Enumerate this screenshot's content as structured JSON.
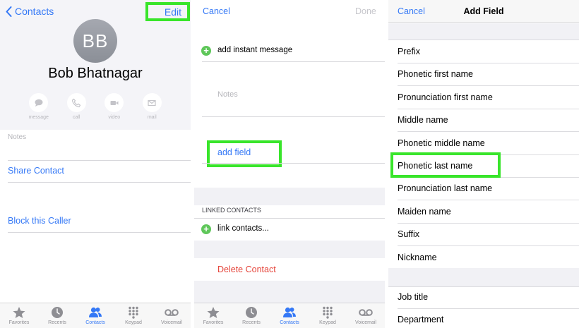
{
  "panel1": {
    "back_label": "Contacts",
    "edit_label": "Edit",
    "avatar_initials": "BB",
    "contact_name": "Bob Bhatnagar",
    "actions": [
      {
        "label": "message",
        "icon": "message-icon"
      },
      {
        "label": "call",
        "icon": "phone-icon"
      },
      {
        "label": "video",
        "icon": "video-icon"
      },
      {
        "label": "mail",
        "icon": "mail-icon"
      }
    ],
    "notes_label": "Notes",
    "share_contact": "Share Contact",
    "block_caller": "Block this Caller"
  },
  "panel2": {
    "cancel_label": "Cancel",
    "done_label": "Done",
    "add_instant_message": "add instant message",
    "notes_placeholder": "Notes",
    "add_field": "add field",
    "linked_header": "LINKED CONTACTS",
    "link_contacts": "link contacts...",
    "delete_contact": "Delete Contact"
  },
  "panel3": {
    "cancel_label": "Cancel",
    "title": "Add Field",
    "fields": [
      "Prefix",
      "Phonetic first name",
      "Pronunciation first name",
      "Middle name",
      "Phonetic middle name",
      "Phonetic last name",
      "Pronunciation last name",
      "Maiden name",
      "Suffix",
      "Nickname"
    ],
    "fields_work": [
      "Job title",
      "Department"
    ]
  },
  "tabbar": {
    "tabs": [
      {
        "label": "Favorites",
        "icon": "star-icon"
      },
      {
        "label": "Recents",
        "icon": "clock-icon"
      },
      {
        "label": "Contacts",
        "icon": "contacts-icon"
      },
      {
        "label": "Keypad",
        "icon": "keypad-icon"
      },
      {
        "label": "Voicemail",
        "icon": "voicemail-icon"
      }
    ],
    "active": "Contacts"
  },
  "colors": {
    "accent": "#3478f6",
    "highlight": "#39e52b",
    "destructive": "#e5443a",
    "add_green": "#5fc75a"
  }
}
